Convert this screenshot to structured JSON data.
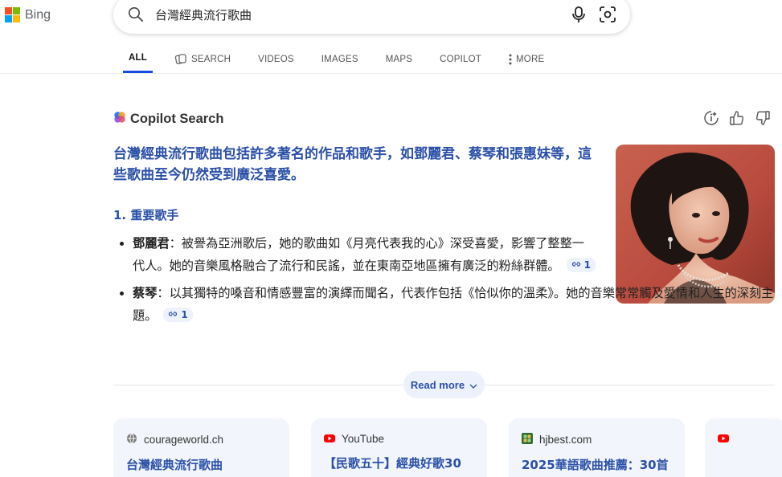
{
  "brand": {
    "name": "Bing",
    "colors": [
      "#f25022",
      "#7fba00",
      "#00a4ef",
      "#ffb900"
    ]
  },
  "search": {
    "query": "台灣經典流行歌曲"
  },
  "tabs": [
    {
      "label": "ALL",
      "active": true,
      "icon": ""
    },
    {
      "label": "SEARCH",
      "active": false,
      "icon": "copilot-search-icon"
    },
    {
      "label": "VIDEOS",
      "active": false,
      "icon": ""
    },
    {
      "label": "IMAGES",
      "active": false,
      "icon": ""
    },
    {
      "label": "MAPS",
      "active": false,
      "icon": ""
    },
    {
      "label": "COPILOT",
      "active": false,
      "icon": ""
    },
    {
      "label": "MORE",
      "active": false,
      "icon": "kebab-icon"
    }
  ],
  "copilot": {
    "title": "Copilot Search",
    "headline": "台灣經典流行歌曲包括許多著名的作品和歌手，如鄧麗君、蔡琴和張惠妹等，這些歌曲至今仍然受到廣泛喜愛。",
    "section_heading": "1. 重要歌手",
    "bullets": [
      {
        "name": "鄧麗君",
        "text": "：被譽為亞洲歌后，她的歌曲如《月亮代表我的心》深受喜愛，影響了整整一代人。她的音樂風格融合了流行和民謠，並在東南亞地區擁有廣泛的粉絲群體。",
        "cite": "1"
      },
      {
        "name": "蔡琴",
        "text": "：以其獨特的嗓音和情感豐富的演繹而聞名，代表作包括《恰似你的溫柔》。她的音樂常常觸及愛情和人生的深刻主題。",
        "cite": "1"
      }
    ],
    "read_more": "Read more"
  },
  "sources": [
    {
      "site": "courageworld.ch",
      "title": "台灣經典流行歌曲",
      "icon": "globe-icon"
    },
    {
      "site": "YouTube",
      "title": "【民歌五十】經典好歌30",
      "icon": "youtube-icon"
    },
    {
      "site": "hjbest.com",
      "title": "2025華語歌曲推薦：30首",
      "icon": "site-favicon-icon"
    },
    {
      "site": "",
      "title": "",
      "icon": "youtube-icon"
    }
  ],
  "accent_color": "#2b50a8"
}
